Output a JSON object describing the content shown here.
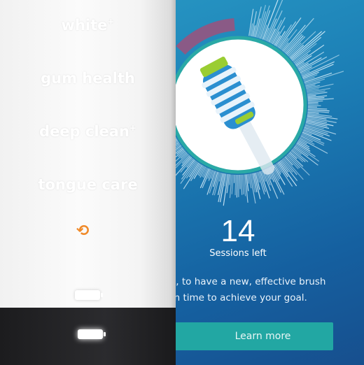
{
  "app": {
    "sessions_count": "14",
    "sessions_label": "Sessions left",
    "message_line1": "ow, to have a new, effective brush",
    "message_line2": "d in time to achieve your goal.",
    "learn_more_label": "Learn more",
    "colors": {
      "accent": "#22a7a3",
      "ring": "#2aa9a6",
      "arc": "#8a5a86",
      "background": "#1c7fb6"
    }
  },
  "handle": {
    "modes": [
      {
        "label": "white",
        "suffix": "+"
      },
      {
        "label": "gum health",
        "suffix": ""
      },
      {
        "label": "deep clean",
        "suffix": "+"
      },
      {
        "label": "tongue care",
        "suffix": ""
      }
    ],
    "icons": [
      "tongue-care-icon",
      "battery-icon"
    ],
    "mode_icon_color": "#f08a2a"
  }
}
